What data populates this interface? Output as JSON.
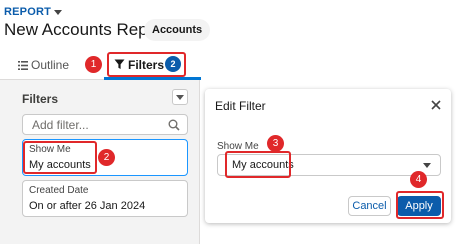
{
  "header": {
    "breadcrumb": "REPORT",
    "title": "New Accounts Report",
    "object_chip": "Accounts"
  },
  "tabs": {
    "outline_label": "Outline",
    "filters_label": "Filters",
    "filters_count": "2"
  },
  "filters_panel": {
    "heading": "Filters",
    "search_placeholder": "Add filter...",
    "cards": [
      {
        "label": "Show Me",
        "value": "My accounts"
      },
      {
        "label": "Created Date",
        "value": "On or after 26 Jan 2024"
      }
    ]
  },
  "edit_filter": {
    "title": "Edit Filter",
    "field_label": "Show Me",
    "selected_value": "My accounts",
    "cancel_label": "Cancel",
    "apply_label": "Apply"
  },
  "annotations": {
    "steps": [
      "1",
      "2",
      "3",
      "4"
    ],
    "color": "#e0282a"
  },
  "colors": {
    "brand": "#0b5cab",
    "focus": "#1b96ff",
    "tab_underline": "#0176d3"
  }
}
